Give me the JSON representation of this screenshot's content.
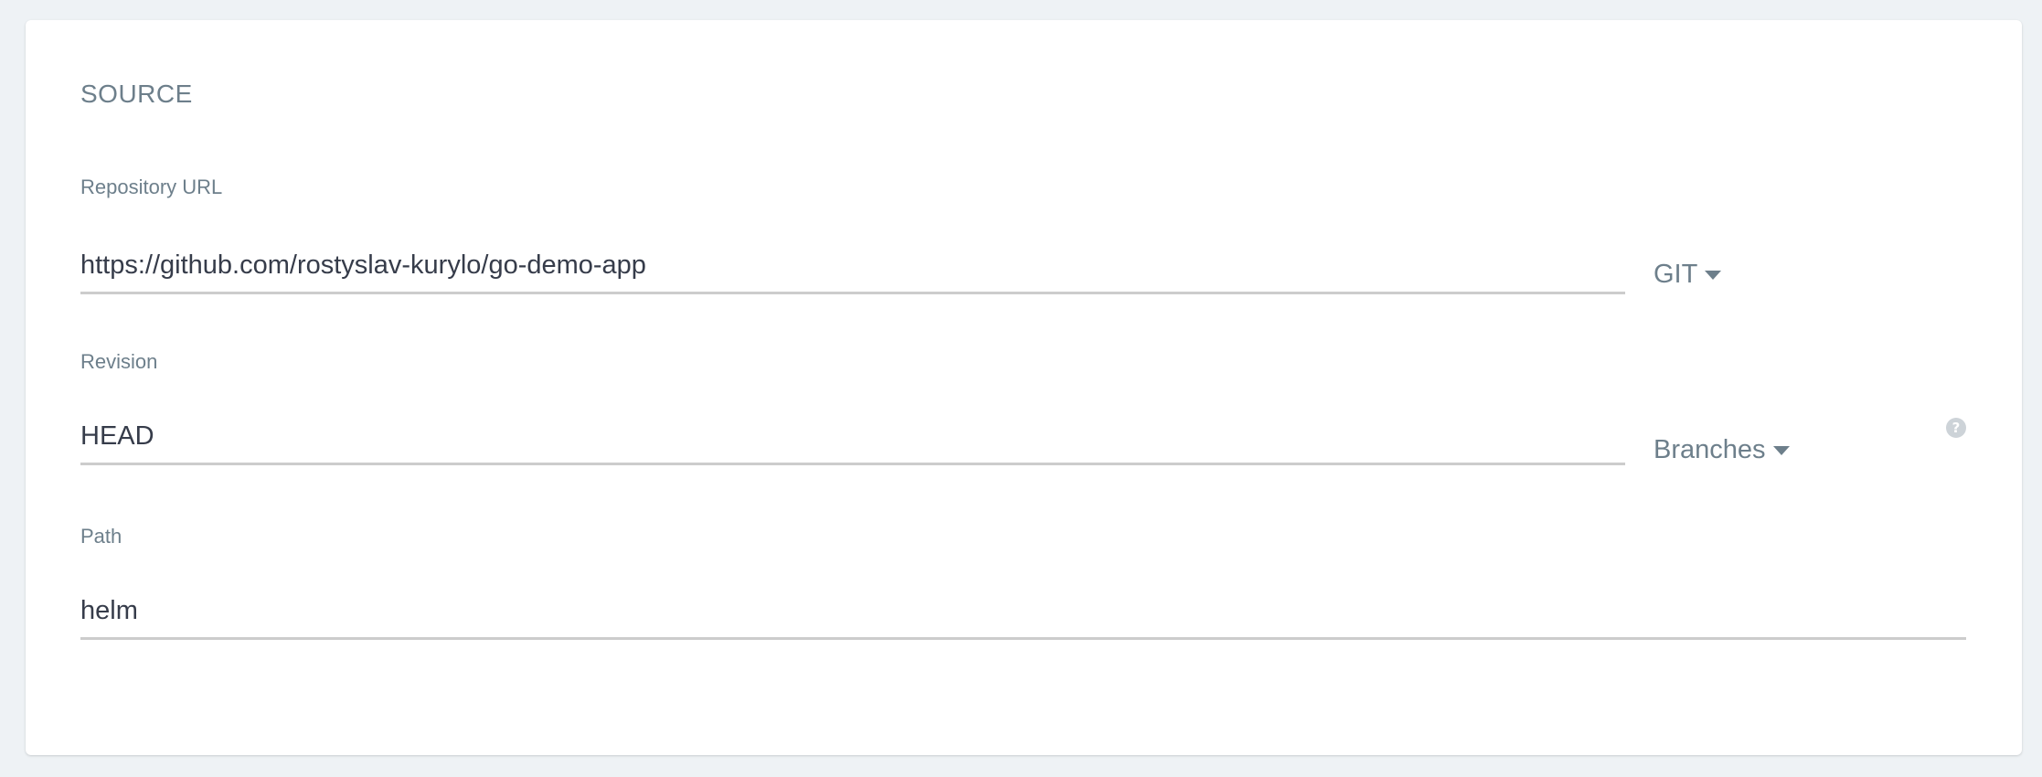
{
  "section": {
    "title": "SOURCE"
  },
  "repository": {
    "label": "Repository URL",
    "value": "https://github.com/rostyslav-kurylo/go-demo-app",
    "type_dropdown": "GIT"
  },
  "revision": {
    "label": "Revision",
    "value": "HEAD",
    "type_dropdown": "Branches",
    "help_icon": "question-circle-icon",
    "help_glyph": "?"
  },
  "path": {
    "label": "Path",
    "value": "helm"
  },
  "colors": {
    "background": "#eef2f5",
    "card": "#ffffff",
    "label": "#6d7f8b",
    "input_text": "#363c4a",
    "underline": "#cccccc",
    "help_icon": "#cdd3d8"
  }
}
